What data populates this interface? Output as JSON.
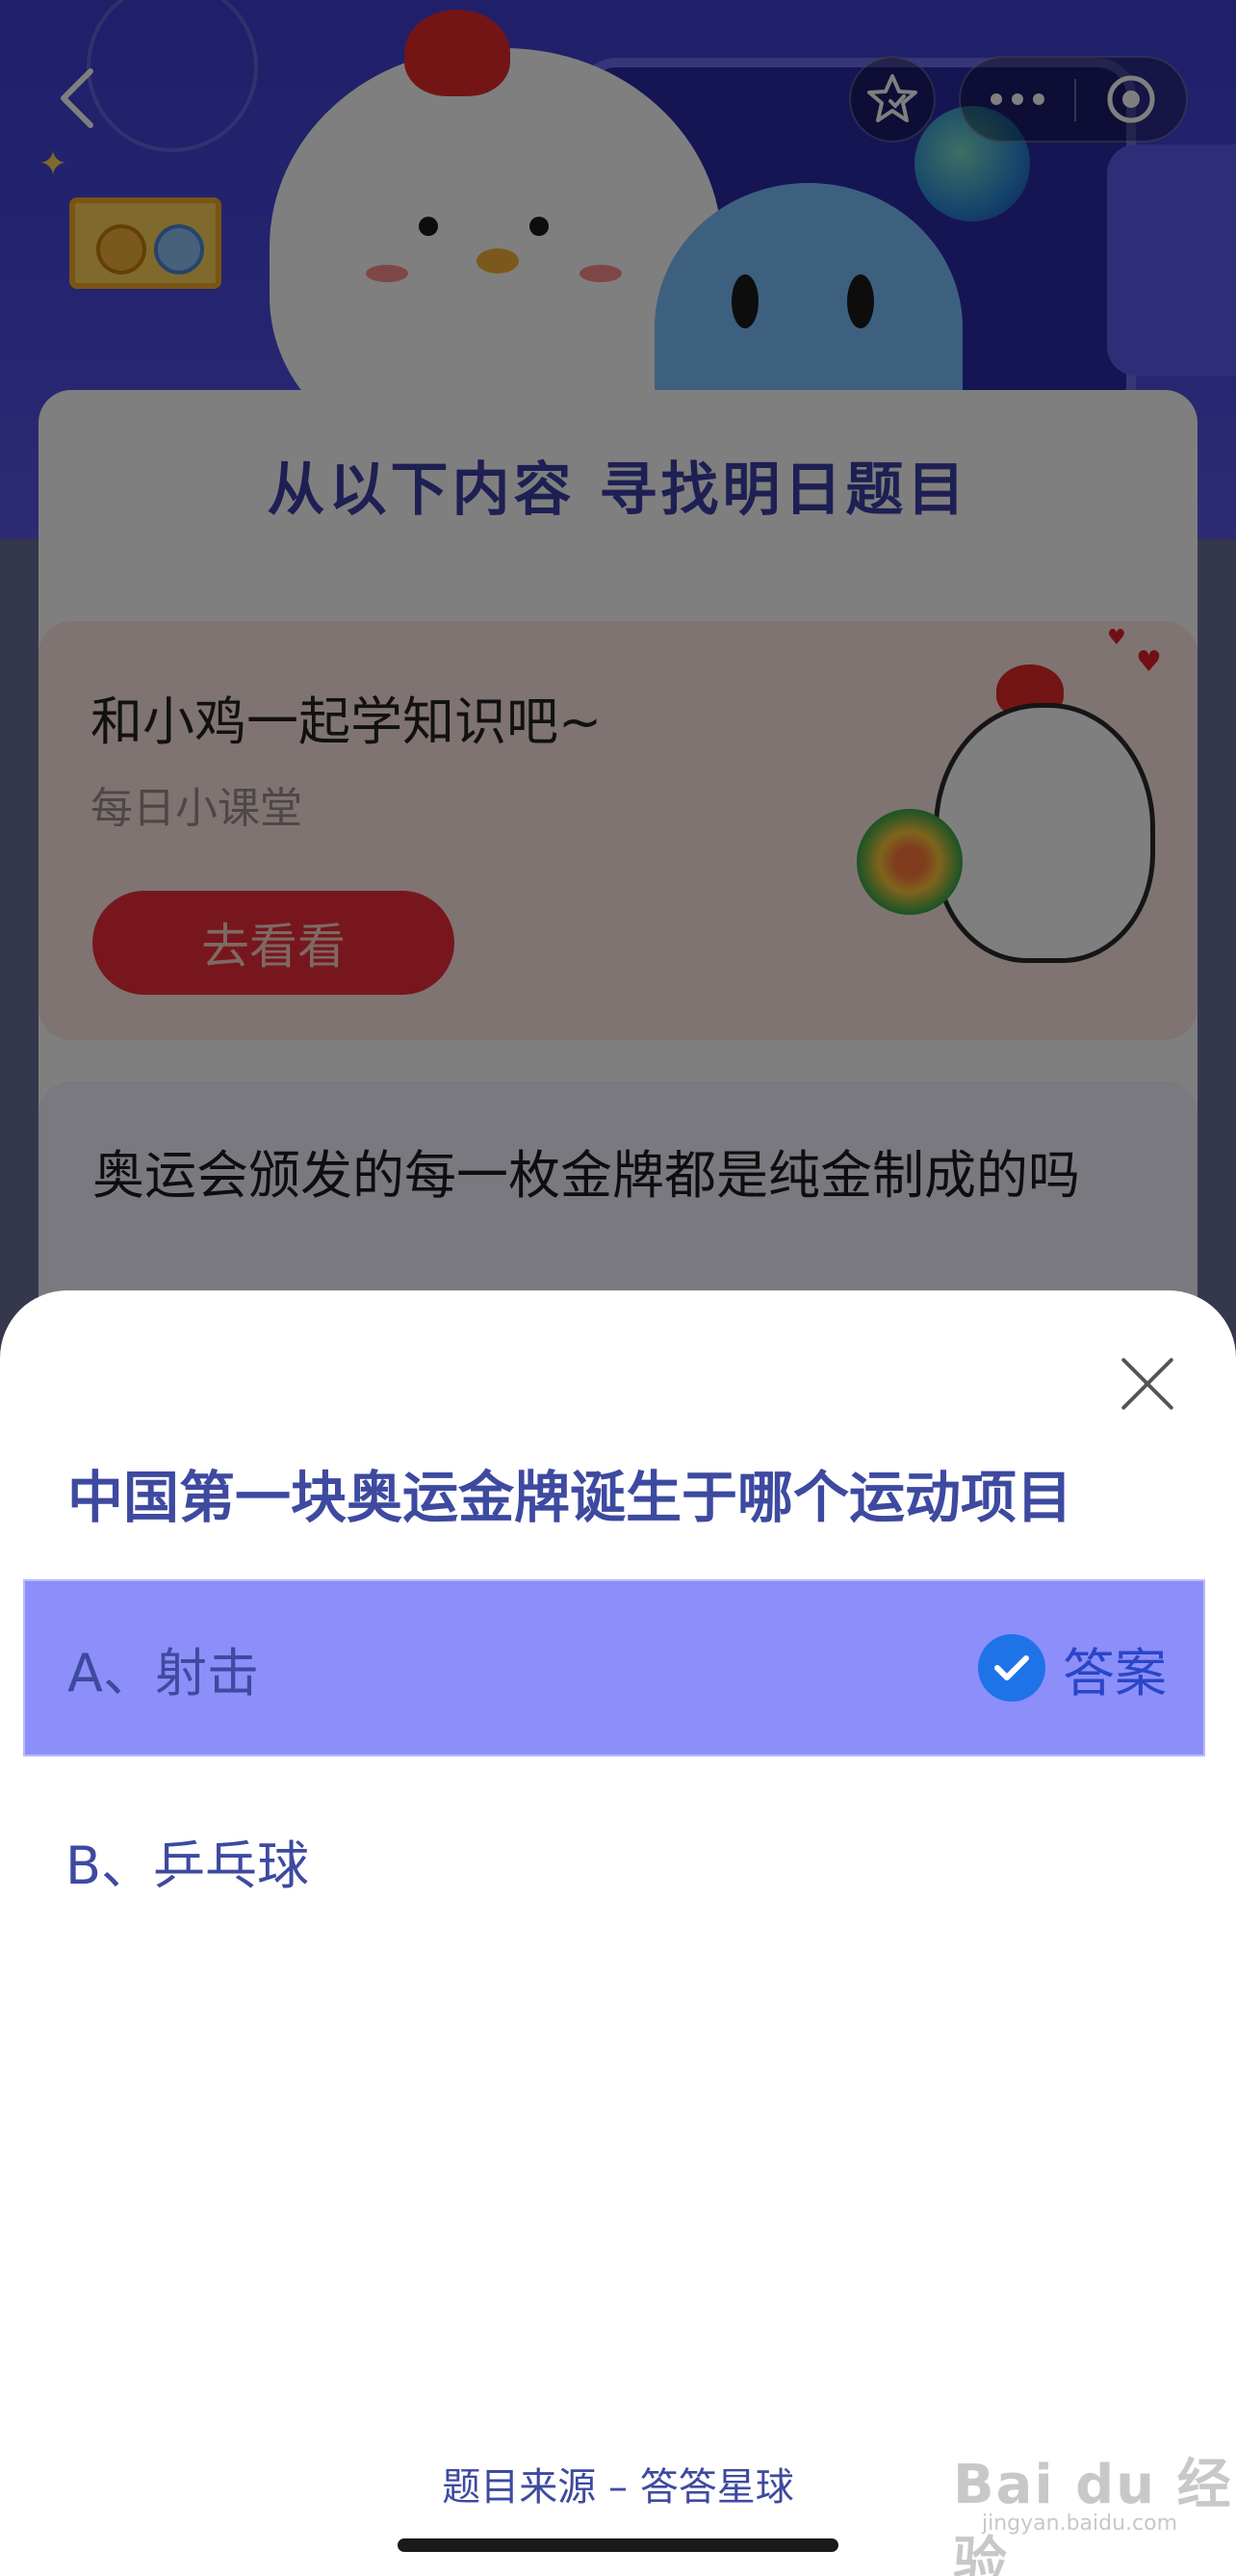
{
  "nav": {
    "back_icon": "chevron-left-icon",
    "favorite_icon": "star-icon",
    "more_icon": "more-dots-icon",
    "close_miniapp_icon": "target-icon"
  },
  "background": {
    "section_title": "从以下内容  寻找明日题目",
    "promo": {
      "title": "和小鸡一起学知识吧~",
      "subtitle": "每日小课堂",
      "button_label": "去看看"
    },
    "quiz_card": {
      "text": "奥运会颁发的每一枚金牌都是纯金制成的吗"
    }
  },
  "sheet": {
    "question": "中国第一块奥运金牌诞生于哪个运动项目",
    "options": [
      {
        "label": "A、射击",
        "is_answer": true
      },
      {
        "label": "B、乒乓球",
        "is_answer": false
      }
    ],
    "answer_label": "答案",
    "source": "题目来源 – 答答星球"
  },
  "watermark": {
    "text": "Bai du 经验",
    "sub": "jingyan.baidu.com"
  },
  "colors": {
    "accent": "#3d4aa0",
    "selected_option": "#8c8ff9",
    "check": "#1e73e8"
  }
}
